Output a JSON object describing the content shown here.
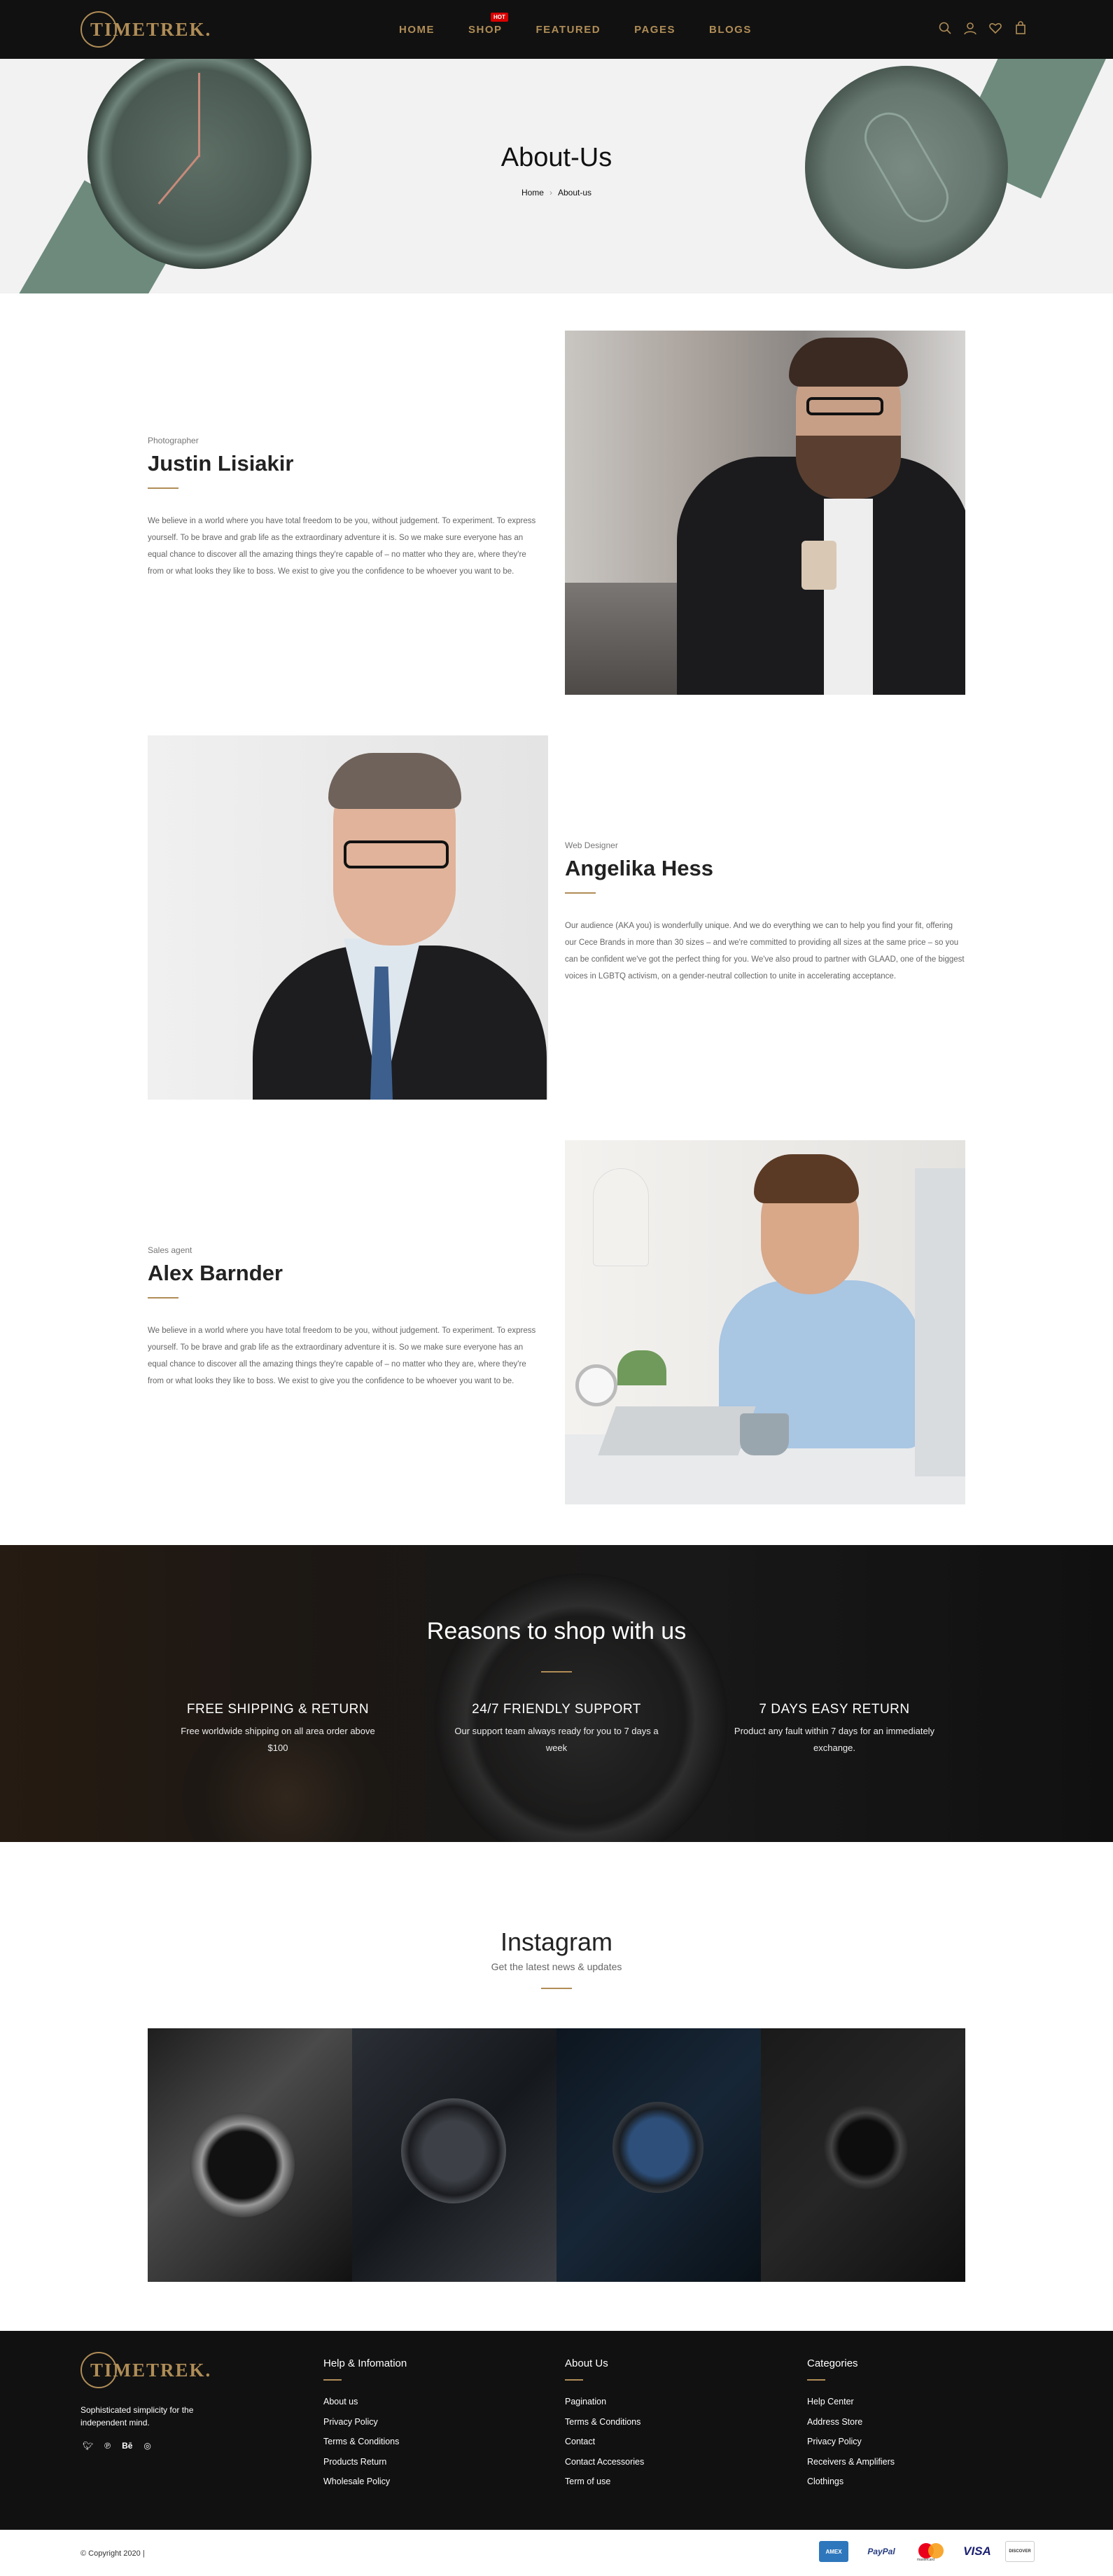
{
  "brand": {
    "logo_text": "TIMETREK.",
    "accent": "#b08d57"
  },
  "nav": {
    "items": [
      "HOME",
      "SHOP",
      "FEATURED",
      "PAGES",
      "BLOGS"
    ],
    "hot_badge": "HOT"
  },
  "header_icons": [
    "search-icon",
    "user-icon",
    "heart-icon",
    "bag-icon"
  ],
  "hero": {
    "title": "About-Us",
    "breadcrumb": [
      "Home",
      "About-us"
    ]
  },
  "team": [
    {
      "role": "Photographer",
      "name": "Justin Lisiakir",
      "desc": "We believe in a world where you have total freedom to be you, without judgement. To experiment. To express yourself. To be brave and grab life as the extraordinary adventure it is. So we make sure everyone has an equal chance to discover all the amazing things they're capable of – no matter who they are, where they're from or what looks they like to boss. We exist to give you the confidence to be whoever you want to be."
    },
    {
      "role": "Web Designer",
      "name": "Angelika Hess",
      "desc": "Our audience (AKA you) is wonderfully unique. And we do everything we can to help you find your fit, offering our Cece Brands in more than 30 sizes – and we're committed to providing all sizes at the same price – so you can be confident we've got the perfect thing for you. We've also proud to partner with GLAAD, one of the biggest voices in LGBTQ activism, on a gender-neutral collection to unite in accelerating acceptance."
    },
    {
      "role": "Sales agent",
      "name": "Alex Barnder",
      "desc": "We believe in a world where you have total freedom to be you, without judgement. To experiment. To express yourself. To be brave and grab life as the extraordinary adventure it is. So we make sure everyone has an equal chance to discover all the amazing things they're capable of – no matter who they are, where they're from or what looks they like to boss. We exist to give you the confidence to be whoever you want to be."
    }
  ],
  "reasons": {
    "title": "Reasons to shop with us",
    "items": [
      {
        "title": "FREE SHIPPING & RETURN",
        "desc": "Free worldwide shipping on all area order above $100"
      },
      {
        "title": "24/7 FRIENDLY SUPPORT",
        "desc": "Our support team always ready for you to 7 days a week"
      },
      {
        "title": "7 DAYS EASY RETURN",
        "desc": "Product any fault within 7 days for an immediately exchange."
      }
    ]
  },
  "instagram": {
    "title": "Instagram",
    "subtitle": "Get the latest news & updates"
  },
  "footer": {
    "tagline": "Sophisticated simplicity for the independent mind.",
    "social": [
      "twitter-icon",
      "pinterest-icon",
      "behance-icon",
      "instagram-icon"
    ],
    "columns": [
      {
        "title": "Help & Infomation",
        "links": [
          "About us",
          "Privacy Policy",
          "Terms & Conditions",
          "Products Return",
          "Wholesale Policy"
        ]
      },
      {
        "title": "About Us",
        "links": [
          "Pagination",
          "Terms & Conditions",
          "Contact",
          "Contact Accessories",
          "Term of use"
        ]
      },
      {
        "title": "Categories",
        "links": [
          "Help Center",
          "Address Store",
          "Privacy Policy",
          "Receivers & Amplifiers",
          "Clothings"
        ]
      }
    ],
    "copyright": "© Copyright 2020 |",
    "payments": [
      "AMEX",
      "PayPal",
      "mastercard",
      "VISA",
      "DISCOVER"
    ]
  }
}
